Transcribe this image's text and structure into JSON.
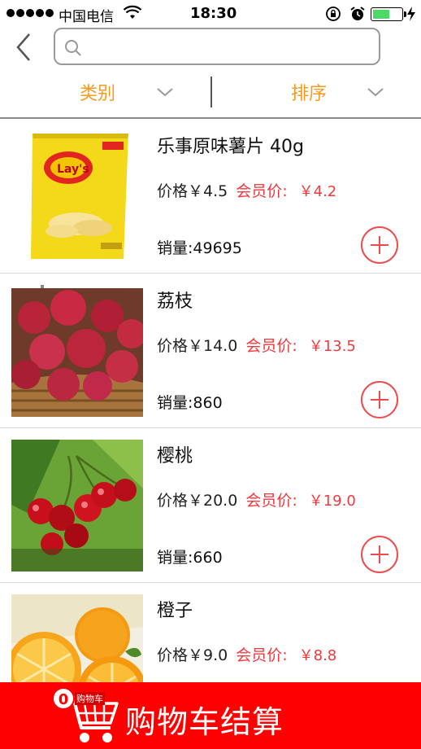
{
  "status_bar": {
    "carrier": "中国电信",
    "time": "18:30",
    "battery_level": 0.6
  },
  "search": {
    "placeholder": "",
    "value": ""
  },
  "filters": {
    "category_label": "类别",
    "sort_label": "排序"
  },
  "colors": {
    "accent_orange": "#f39a1f",
    "member_red": "#f0393d",
    "cart_bar_red": "#ff0000"
  },
  "products": [
    {
      "name": "乐事原味薯片 40g",
      "price_label": "价格￥4.5",
      "member_label": "会员价:",
      "member_price": "￥4.2",
      "sales": "销量:49695",
      "thumb": "chips-bag-image"
    },
    {
      "name": "荔枝",
      "price_label": "价格￥14.0",
      "member_label": "会员价:",
      "member_price": "￥13.5",
      "sales": "销量:860",
      "thumb": "lychee-image"
    },
    {
      "name": "樱桃",
      "price_label": "价格￥20.0",
      "member_label": "会员价:",
      "member_price": "￥19.0",
      "sales": "销量:660",
      "thumb": "cherry-image"
    },
    {
      "name": "橙子",
      "price_label": "价格￥9.0",
      "member_label": "会员价:",
      "member_price": "￥8.8",
      "sales": "",
      "thumb": "orange-image"
    }
  ],
  "cart": {
    "count": "0",
    "icon_tag": "购物车",
    "checkout_label": "购物车结算"
  }
}
